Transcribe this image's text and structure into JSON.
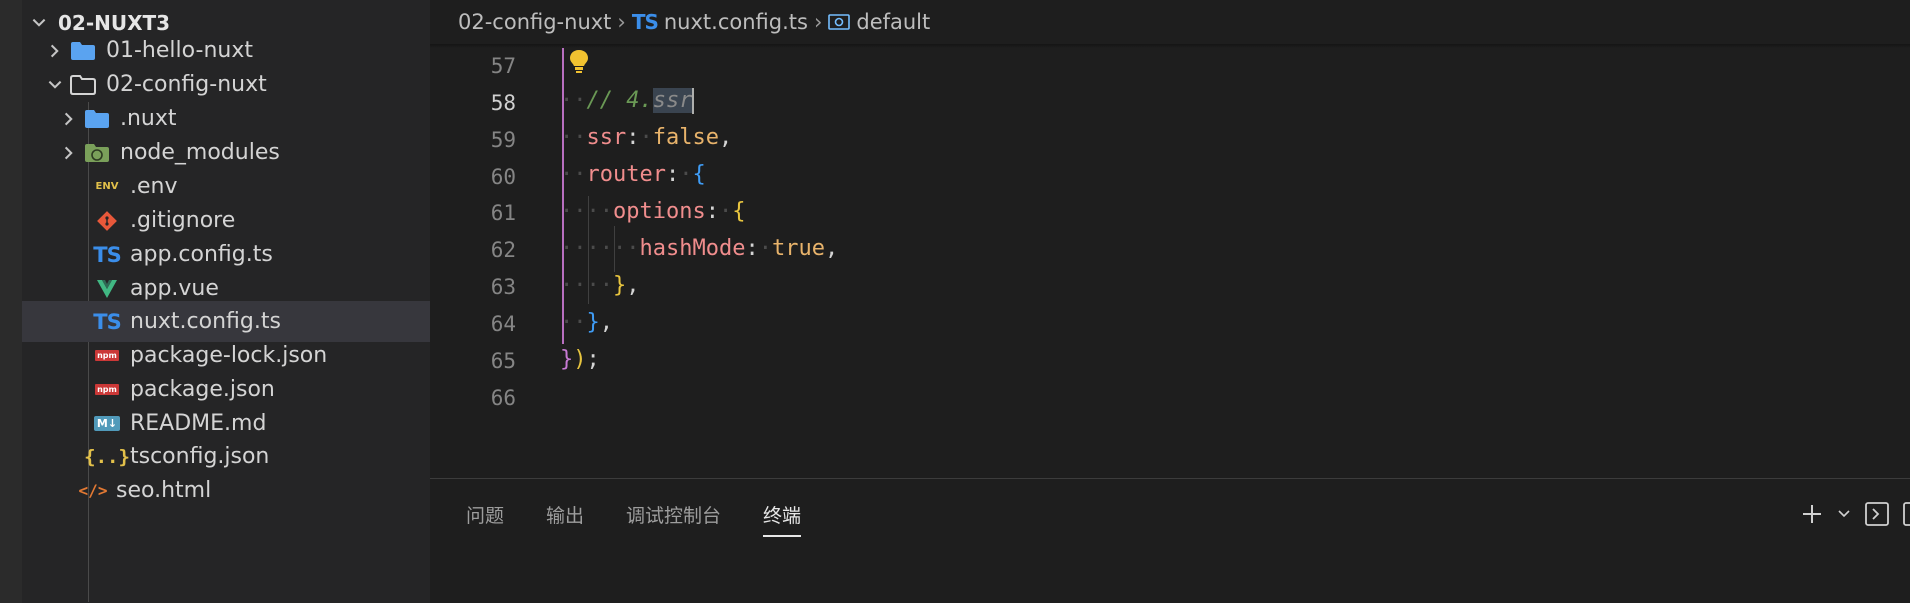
{
  "explorer": {
    "root_label": "02-NUXT3",
    "items": [
      {
        "label": "01-hello-nuxt",
        "icon": "folder-icon"
      },
      {
        "label": "02-config-nuxt",
        "icon": "folder-open-icon"
      },
      {
        "label": ".nuxt",
        "icon": "folder-icon"
      },
      {
        "label": "node_modules",
        "icon": "node-modules-folder-icon"
      },
      {
        "label": ".env",
        "icon": "env-file-icon",
        "badge": "ENV"
      },
      {
        "label": ".gitignore",
        "icon": "git-icon"
      },
      {
        "label": "app.config.ts",
        "icon": "typescript-icon",
        "badge": "TS"
      },
      {
        "label": "app.vue",
        "icon": "vue-icon"
      },
      {
        "label": "nuxt.config.ts",
        "icon": "typescript-icon",
        "badge": "TS"
      },
      {
        "label": "package-lock.json",
        "icon": "npm-icon",
        "badge": "npm"
      },
      {
        "label": "package.json",
        "icon": "npm-icon",
        "badge": "npm"
      },
      {
        "label": "README.md",
        "icon": "markdown-icon",
        "badge": "M↓"
      },
      {
        "label": "tsconfig.json",
        "icon": "json-icon",
        "badge": "{..}"
      },
      {
        "label": "seo.html",
        "icon": "html-icon",
        "badge": "</>"
      }
    ]
  },
  "breadcrumb": {
    "folder": "02-config-nuxt",
    "file": "nuxt.config.ts",
    "file_badge": "TS",
    "symbol": "default"
  },
  "editor": {
    "line_numbers": [
      "57",
      "58",
      "59",
      "60",
      "61",
      "62",
      "63",
      "64",
      "65",
      "66"
    ],
    "active_line": "58",
    "code": {
      "l58_comment": "// 4.",
      "l58_sel": "ssr",
      "l59_key": "ssr",
      "l59_val": "false",
      "l60_key": "router",
      "l61_key": "options",
      "l62_key": "hashMode",
      "l62_val": "true"
    }
  },
  "panel": {
    "tabs": [
      "问题",
      "输出",
      "调试控制台",
      "终端"
    ],
    "active_tab": "终端"
  },
  "colors": {
    "ts_blue": "#3b8eea",
    "folder_blue": "#5aa3f0",
    "vue_green": "#41b883",
    "git_orange": "#e8583a",
    "npm_red": "#cb3837",
    "comment_green": "#6a9955"
  }
}
